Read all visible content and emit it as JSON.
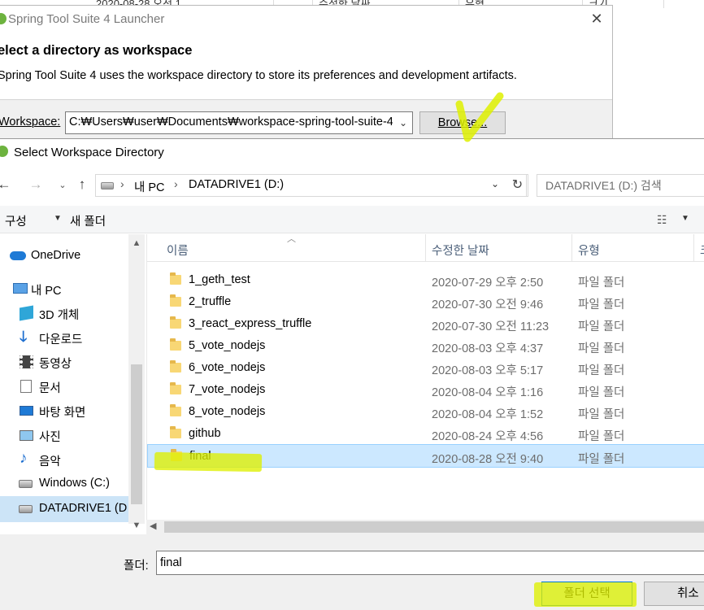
{
  "background_explorer": {
    "date_text": "2020-08-28 오전 1",
    "col_modified": "수정한 날짜",
    "col_type": "유형",
    "col_size": "크기"
  },
  "launcher": {
    "title": "Spring Tool Suite 4 Launcher",
    "close_glyph": "✕",
    "heading": "elect a directory as workspace",
    "description": "Spring Tool Suite 4 uses the workspace directory to store its preferences and development artifacts.",
    "workspace_label": "Workspace:",
    "workspace_value": "C:₩Users₩user₩Documents₩workspace-spring-tool-suite-4",
    "browse_label": "Browse..."
  },
  "dialog": {
    "title": "Select Workspace Directory",
    "nav": {
      "back_glyph": "←",
      "forward_glyph": "→",
      "recent_glyph": "⌄",
      "up_glyph": "↑",
      "path_sep": "›",
      "path_pc": "내 PC",
      "path_drive": "DATADRIVE1 (D:)",
      "refresh_glyph": "↻",
      "search_placeholder": "DATADRIVE1 (D:) 검색"
    },
    "toolbar": {
      "organize_label": "구성",
      "organize_caret": "▼",
      "new_folder_label": "새 폴더",
      "view_glyph": "☷",
      "view_caret": "▼"
    },
    "nav_pane": {
      "items": [
        {
          "label": "OneDrive",
          "icon": "cloud-icon"
        },
        {
          "label": "내 PC",
          "icon": "computer-icon"
        },
        {
          "label": "3D 개체",
          "icon": "cube-icon"
        },
        {
          "label": "다운로드",
          "icon": "download-icon"
        },
        {
          "label": "동영상",
          "icon": "video-icon"
        },
        {
          "label": "문서",
          "icon": "document-icon"
        },
        {
          "label": "바탕 화면",
          "icon": "desktop-icon"
        },
        {
          "label": "사진",
          "icon": "pictures-icon"
        },
        {
          "label": "음악",
          "icon": "music-icon"
        },
        {
          "label": "Windows (C:)",
          "icon": "drive-icon"
        },
        {
          "label": "DATADRIVE1 (D",
          "icon": "drive-icon"
        }
      ]
    },
    "columns": {
      "name": "이름",
      "modified": "수정한 날짜",
      "type": "유형",
      "size": "크"
    },
    "files": [
      {
        "name": "1_geth_test",
        "modified": "2020-07-29 오후 2:50",
        "type": "파일 폴더"
      },
      {
        "name": "2_truffle",
        "modified": "2020-07-30 오전 9:46",
        "type": "파일 폴더"
      },
      {
        "name": "3_react_express_truffle",
        "modified": "2020-07-30 오전 11:23",
        "type": "파일 폴더"
      },
      {
        "name": "5_vote_nodejs",
        "modified": "2020-08-03 오후 4:37",
        "type": "파일 폴더"
      },
      {
        "name": "6_vote_nodejs",
        "modified": "2020-08-03 오후 5:17",
        "type": "파일 폴더"
      },
      {
        "name": "7_vote_nodejs",
        "modified": "2020-08-04 오후 1:16",
        "type": "파일 폴더"
      },
      {
        "name": "8_vote_nodejs",
        "modified": "2020-08-04 오후 1:52",
        "type": "파일 폴더"
      },
      {
        "name": "github",
        "modified": "2020-08-24 오후 4:56",
        "type": "파일 폴더"
      },
      {
        "name": "final",
        "modified": "2020-08-28 오전 9:40",
        "type": "파일 폴더"
      }
    ],
    "folder_label": "폴더:",
    "folder_value": "final",
    "select_button": "폴더 선택",
    "cancel_button": "취소",
    "scroll_up_glyph": "▲",
    "scroll_down_glyph": "▼",
    "scroll_left_glyph": "◀",
    "sort_glyph": "︿"
  },
  "colors": {
    "highlight": "#def000",
    "selection": "#cce8ff",
    "spring_green": "#6db33f"
  }
}
